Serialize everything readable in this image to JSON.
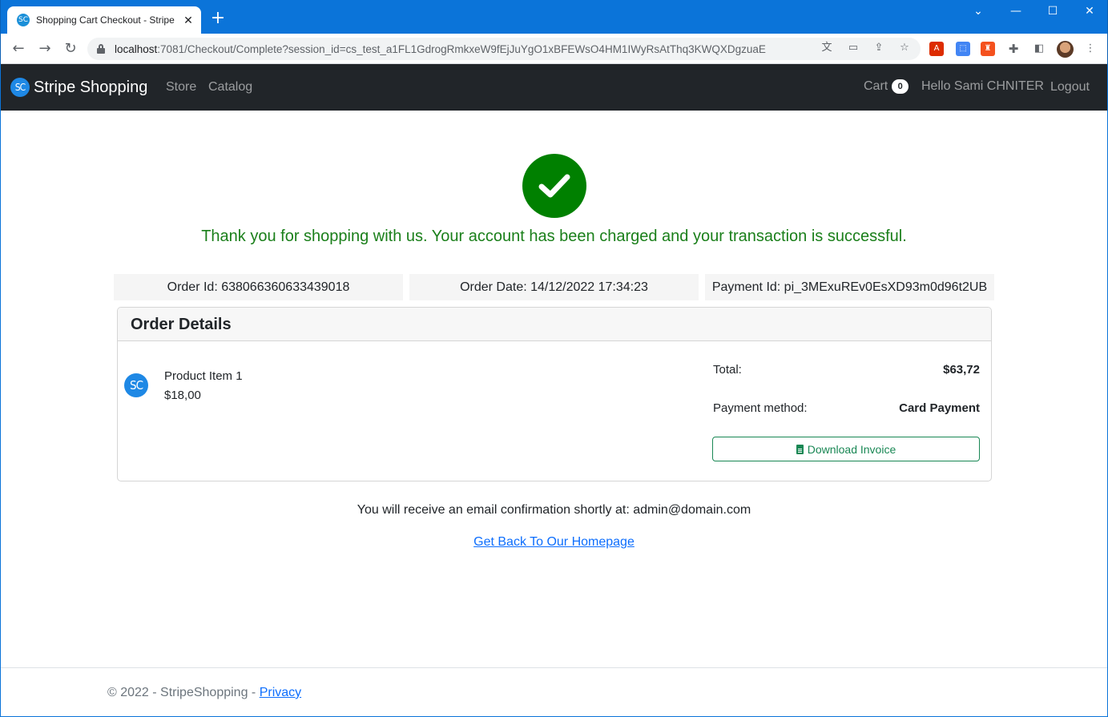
{
  "browser": {
    "tab_title": "Shopping Cart Checkout - Stripe",
    "tab_favicon": "SC",
    "url_host": "localhost",
    "url_rest": ":7081/Checkout/Complete?session_id=cs_test_a1FL1GdrogRmkxeW9fEjJuYgO1xBFEWsO4HM1IWyRsAtThq3KWQXDgzuaE",
    "icons": [
      "back-icon",
      "forward-icon",
      "reload-icon",
      "lock-icon",
      "translate-icon",
      "install-icon",
      "share-icon",
      "star-icon",
      "angular-extension-icon",
      "extension-icon",
      "extension-icon-2",
      "puzzle-icon",
      "sidepanel-icon",
      "profile-avatar",
      "menu-icon"
    ]
  },
  "navbar": {
    "logo": "SC",
    "brand": "Stripe Shopping",
    "links": [
      "Store",
      "Catalog"
    ],
    "cart_label": "Cart",
    "cart_count": "0",
    "greeting": "Hello Sami CHNITER",
    "logout": "Logout"
  },
  "confirmation": {
    "message": "Thank you for shopping with us. Your account has been charged and your transaction is successful.",
    "order_id": "Order Id: 638066360633439018",
    "order_date": "Order Date: 14/12/2022 17:34:23",
    "payment_id": "Payment Id: pi_3MExuREv0EsXD93m0d96t2UB",
    "success_color": "#008000"
  },
  "order": {
    "header": "Order Details",
    "items": [
      {
        "logo": "SC",
        "name": "Product Item 1",
        "price": "$18,00"
      }
    ],
    "total_label": "Total:",
    "total_value": "$63,72",
    "payment_method_label": "Payment method:",
    "payment_method_value": "Card Payment",
    "download_label": "Download Invoice"
  },
  "email_message": "You will receive an email confirmation shortly at: admin@domain.com",
  "home_link": "Get Back To Our Homepage",
  "footer": {
    "copyright": "© 2022 - StripeShopping - ",
    "privacy": "Privacy"
  }
}
